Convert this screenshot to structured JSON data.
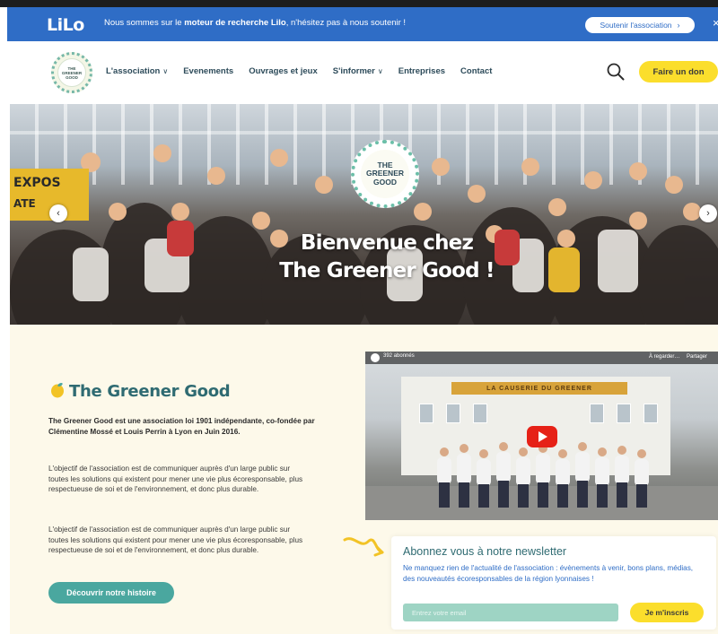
{
  "lilo_banner": {
    "logo": "LiLo",
    "message_prefix": "Nous sommes sur le ",
    "message_bold": "moteur de recherche Lilo",
    "message_suffix": ", n'hésitez pas à nous soutenir !",
    "support_label": "Soutenir l'association",
    "close_label": "×"
  },
  "nav": {
    "logo_lines": [
      "THE",
      "GREENER",
      "GOOD"
    ],
    "items": [
      {
        "label": "L'association",
        "has_dropdown": true
      },
      {
        "label": "Evenements",
        "has_dropdown": false
      },
      {
        "label": "Ouvrages et jeux",
        "has_dropdown": false
      },
      {
        "label": "S'informer",
        "has_dropdown": true
      },
      {
        "label": "Entreprises",
        "has_dropdown": false
      },
      {
        "label": "Contact",
        "has_dropdown": false
      }
    ],
    "donate_label": "Faire un don",
    "search_icon": "search-icon"
  },
  "hero": {
    "badge_lines": [
      "THE",
      "GREENER",
      "GOOD"
    ],
    "title_line1": "Bienvenue chez",
    "title_line2": "The Greener Good !",
    "sign_text_1": "EXPOS",
    "sign_text_2": "ATE",
    "prev_label": "‹",
    "next_label": "›"
  },
  "about": {
    "title": "The Greener Good",
    "lead": "The Greener Good est une association loi 1901 indépendante, co-fondée par Clémentine Mossé et Louis Perrin à Lyon en Juin 2016.",
    "paragraph1": "L'objectif de l'association est de communiquer auprès d'un large public sur toutes les solutions qui existent pour mener une vie plus écoresponsable, plus respectueuse de soi et de l'environnement, et donc plus durable.",
    "paragraph2": "L'objectif de l'association est de communiquer auprès d'un large public sur toutes les solutions qui existent pour mener une vie plus écoresponsable, plus respectueuse de soi et de l'environnement, et donc plus durable.",
    "history_button": "Découvrir notre histoire"
  },
  "video": {
    "channel": "392 abonnés",
    "watch_later": "À regarder…",
    "share": "Partager",
    "banner_text": "LA CAUSERIE DU GREENER"
  },
  "newsletter": {
    "title": "Abonnez vous à notre newsletter",
    "text": "Ne manquez rien de l'actualité de l'association : évènements à venir, bons plans, médias, des nouveautés écoresponsables de la région lyonnaises !",
    "email_placeholder": "Entrez votre email",
    "email_value": "",
    "subscribe_label": "Je m'inscris"
  },
  "colors": {
    "lilo_blue": "#2f6dc6",
    "brand_yellow": "#fbde2c",
    "brand_teal": "#4aa79f",
    "heading_teal": "#2f6b72",
    "section_cream": "#fdf9ea"
  }
}
